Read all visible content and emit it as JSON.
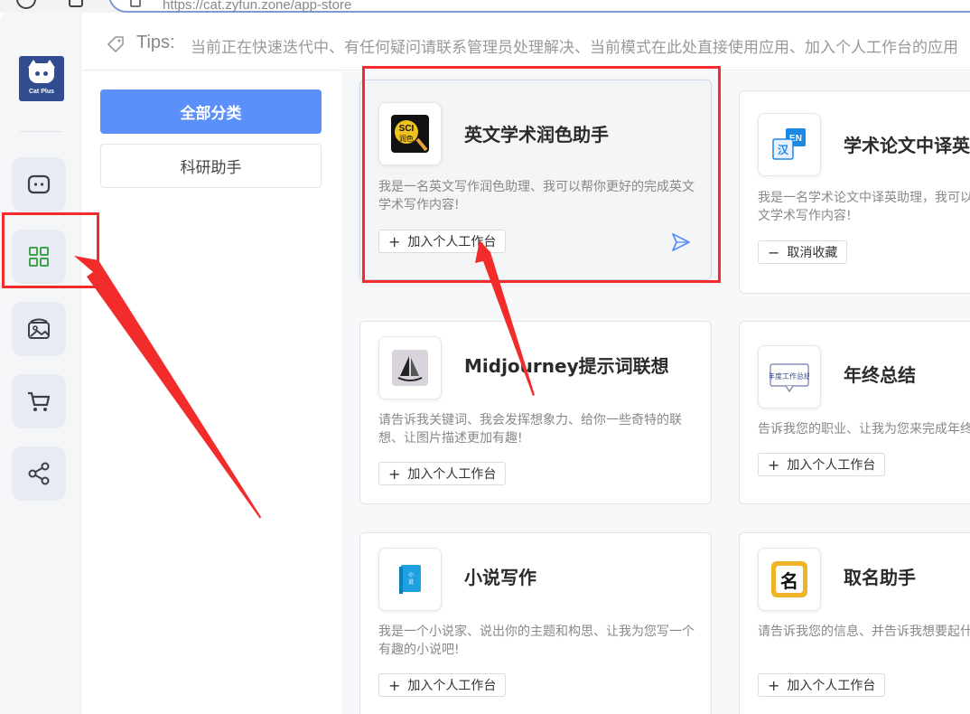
{
  "browser": {
    "url": "https://cat.zyfun.zone/app-store"
  },
  "logo": {
    "text": "Cat Plus"
  },
  "rail": {
    "items": [
      {
        "name": "chat",
        "icon": "chat-bot-icon"
      },
      {
        "name": "apps",
        "icon": "grid-icon",
        "active": true
      },
      {
        "name": "gallery",
        "icon": "image-icon"
      },
      {
        "name": "cart",
        "icon": "cart-icon"
      },
      {
        "name": "share",
        "icon": "share-icon"
      }
    ]
  },
  "tips": {
    "label": "Tips:",
    "text": "当前正在快速迭代中、有任何疑问请联系管理员处理解决、当前模式在此处直接使用应用、加入个人工作台的应用"
  },
  "categories": [
    {
      "label": "全部分类",
      "active": true
    },
    {
      "label": "科研助手",
      "active": false
    }
  ],
  "apps": [
    {
      "title": "英文学术润色助手",
      "desc": "我是一名英文写作润色助理、我可以帮你更好的完成英文学术写作内容!",
      "button": "加入个人工作台",
      "button_symbol": "+",
      "icon": "sci-polish-icon"
    },
    {
      "title": "学术论文中译英",
      "desc": "我是一名学术论文中译英助理，我可以帮你更好的完成英文学术写作内容!",
      "button": "取消收藏",
      "button_symbol": "−",
      "icon": "translate-zh-en-icon"
    },
    {
      "title": "Midjourney提示词联想",
      "desc": "请告诉我关键词、我会发挥想象力、给你一些奇特的联想、让图片描述更加有趣!",
      "button": "加入个人工作台",
      "button_symbol": "+",
      "icon": "sailboat-icon"
    },
    {
      "title": "年终总结",
      "desc": "告诉我您的职业、让我为您来完成年终总结吧!",
      "button": "加入个人工作台",
      "button_symbol": "+",
      "icon": "year-summary-icon"
    },
    {
      "title": "小说写作",
      "desc": "我是一个小说家、说出你的主题和构思、让我为您写一个有趣的小说吧!",
      "button": "加入个人工作台",
      "button_symbol": "+",
      "icon": "novel-book-icon"
    },
    {
      "title": "取名助手",
      "desc": "请告诉我您的信息、并告诉我想要起什么名字?",
      "button": "加入个人工作台",
      "button_symbol": "+",
      "icon": "naming-icon"
    }
  ],
  "colors": {
    "accent": "#5b8ff9",
    "annotation_red": "#f22b2b",
    "rail_bg": "#f5f6f8",
    "active_icon": "#3fa34d"
  }
}
